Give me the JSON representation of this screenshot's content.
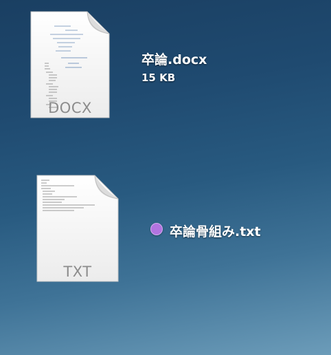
{
  "desktop": {
    "items": [
      {
        "name": "卒論.docx",
        "size": "15 KB",
        "type_label": "DOCX",
        "icon": "docx-document-icon"
      },
      {
        "name": "卒論骨組み.txt",
        "type_label": "TXT",
        "icon": "txt-document-icon",
        "tag_color": "#b274e0"
      }
    ]
  }
}
